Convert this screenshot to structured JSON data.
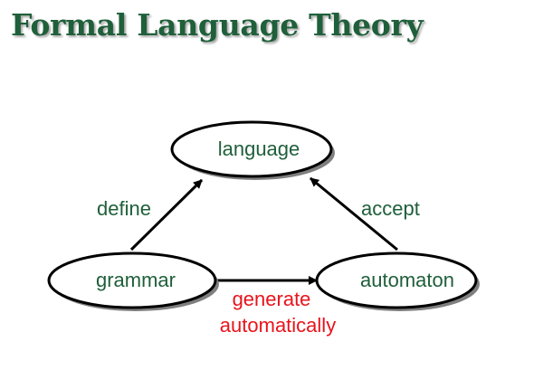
{
  "title": "Formal Language Theory",
  "colors": {
    "title": "#1f5f3a",
    "node_text": "#1f5f3a",
    "edge_label": "#1f5f3a",
    "highlight": "#e8141c",
    "stroke": "#000000",
    "node_fill": "#ffffff",
    "shadow": "#7f7f7f"
  },
  "nodes": {
    "language": "language",
    "grammar": "grammar",
    "automaton": "automaton"
  },
  "edges": {
    "define": "define",
    "accept": "accept",
    "generate_line1": "generate",
    "generate_line2": "automatically"
  }
}
